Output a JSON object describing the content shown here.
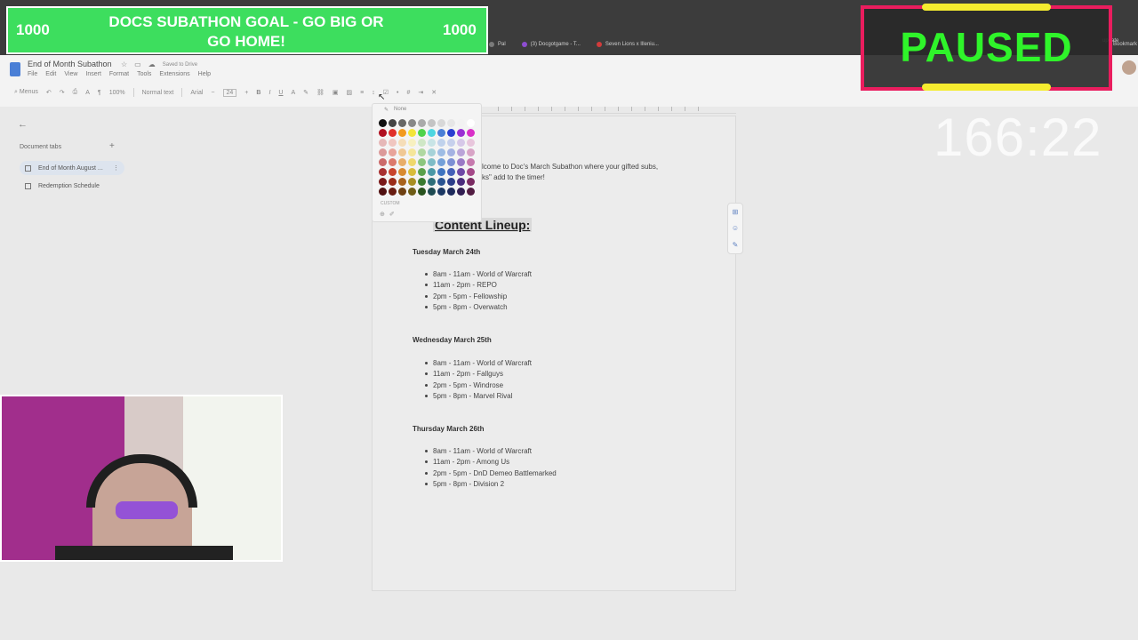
{
  "browser": {
    "tabs": [
      {
        "label": "Pal",
        "color": "#7a7a7a"
      },
      {
        "label": "(3) Docgotgame - T...",
        "color": "#8d4dd1"
      },
      {
        "label": "Seven Lions x Illeniu...",
        "color": "#d23b3b"
      }
    ],
    "update_label": "update",
    "bookmarks_label": "Bookmark"
  },
  "docs": {
    "title": "End of Month Subathon",
    "saved_status": "Saved to Drive",
    "menu": [
      "File",
      "Edit",
      "View",
      "Insert",
      "Format",
      "Tools",
      "Extensions",
      "Help"
    ],
    "toolbar": {
      "menus": "Menus",
      "zoom": "100%",
      "style": "Normal text",
      "font": "Arial",
      "font_size": "24"
    },
    "left_panel": {
      "heading": "Document tabs",
      "tabs": [
        "End of Month August ...",
        "Redemption Schedule"
      ]
    },
    "color_picker": {
      "none_label": "None",
      "custom_label": "CUSTOM"
    }
  },
  "content": {
    "intro_line1": "lcome to Doc's March Subathon where your gifted subs,",
    "intro_line2": "ks\" add to the timer!",
    "title": "Content Lineup:",
    "days": [
      {
        "heading": "Tuesday March 24th",
        "items": [
          "8am - 11am - World of Warcraft",
          "11am - 2pm - REPO",
          "2pm - 5pm - Fellowship",
          "5pm - 8pm - Overwatch"
        ]
      },
      {
        "heading": "Wednesday March 25th",
        "items": [
          "8am - 11am - World of Warcraft",
          "11am - 2pm - Fallguys",
          "2pm - 5pm - Windrose",
          "5pm - 8pm - Marvel Rival"
        ]
      },
      {
        "heading": "Thursday March 26th",
        "items": [
          "8am - 11am - World of Warcraft",
          "11am - 2pm - Among Us",
          "2pm - 5pm - DnD Demeo Battlemarked",
          "5pm - 8pm - Division 2"
        ]
      }
    ]
  },
  "overlay": {
    "goal_left": "1000",
    "goal_right": "1000",
    "goal_text_line1": "DOCS SUBATHON GOAL - GO BIG OR",
    "goal_text_line2": "GO HOME!",
    "paused": "PAUSED",
    "timer": "166:22"
  },
  "colors": {
    "goal_green": "#3dde5e",
    "paused_border": "#ea1d5e",
    "paused_text": "#2ff42a",
    "stripe_yellow": "#f5ec2f"
  }
}
